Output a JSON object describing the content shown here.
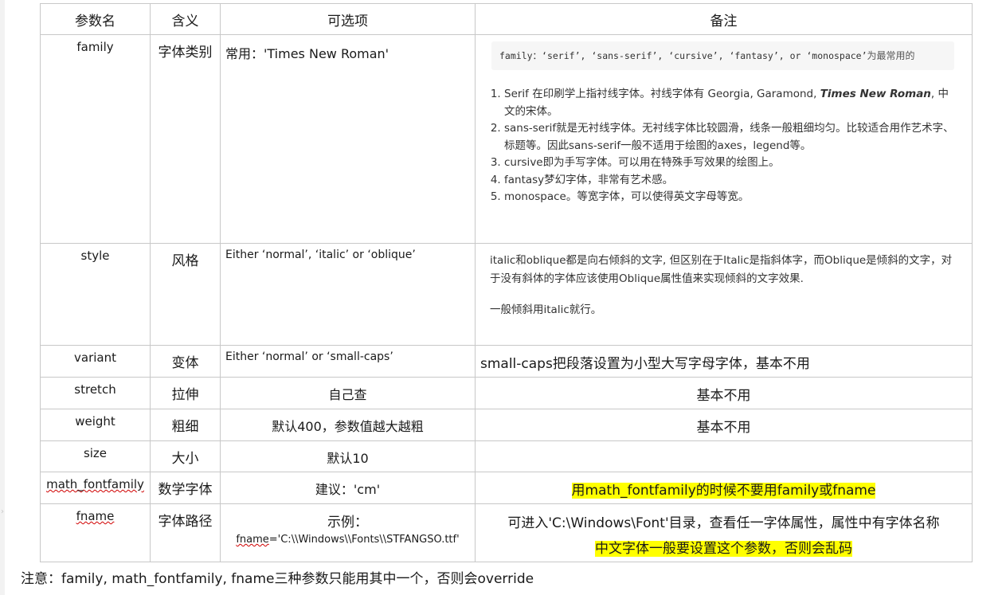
{
  "headers": {
    "name": "参数名",
    "meaning": "含义",
    "options": "可选项",
    "remarks": "备注"
  },
  "rows": {
    "family": {
      "name": "family",
      "meaning": "字体类别",
      "options": "常用：'Times New Roman'",
      "code_en": "family：‘serif’, ‘sans-serif’, ‘cursive’, ‘fantasy’, or ‘monospace’",
      "code_cn": "为最常用的",
      "list": [
        {
          "pre": "Serif 在印刷学上指衬线字体。衬线字体有 Georgia, Garamond, ",
          "emph": "Times New Roman",
          "post": ", 中文的宋体。"
        },
        {
          "text": "sans-serif就是无衬线字体。无衬线字体比较圆滑，线条一般粗细均匀。比较适合用作艺术字、标题等。因此sans-serif一般不适用于绘图的axes，legend等。"
        },
        {
          "text": "cursive即为手写字体。可以用在特殊手写效果的绘图上。"
        },
        {
          "text": "fantasy梦幻字体，非常有艺术感。"
        },
        {
          "text": "monospace。等宽字体，可以使得英文字母等宽。"
        }
      ]
    },
    "style": {
      "name": "style",
      "meaning": "风格",
      "options": "Either ‘normal’, ‘italic’ or ‘oblique’",
      "note1": "italic和oblique都是向右倾斜的文字, 但区别在于Italic是指斜体字，而Oblique是倾斜的文字，对于没有斜体的字体应该使用Oblique属性值来实现倾斜的文字效果.",
      "note2": "一般倾斜用italic就行。"
    },
    "variant": {
      "name": "variant",
      "meaning": "变体",
      "options": "Either ‘normal’ or ‘small-caps’",
      "remark": "small-caps把段落设置为小型大写字母字体，基本不用"
    },
    "stretch": {
      "name": "stretch",
      "meaning": "拉伸",
      "options": "自己查",
      "remark": "基本不用"
    },
    "weight": {
      "name": "weight",
      "meaning": "粗细",
      "options": "默认400，参数值越大越粗",
      "remark": "基本不用"
    },
    "size": {
      "name": "size",
      "meaning": "大小",
      "options": "默认10",
      "remark": ""
    },
    "math": {
      "name": "math_fontfamily",
      "meaning": "数学字体",
      "options": "建议：'cm'",
      "remark": "用math_fontfamily的时候不要用family或fname"
    },
    "fname": {
      "name": "fname",
      "meaning": "字体路径",
      "options_label": "示例：",
      "options_code_kw": "fname",
      "options_code_rest": "='C:\\\\Windows\\\\Fonts\\\\STFANGSO.ttf'",
      "remark1": "可进入'C:\\Windows\\Font'目录，查看任一字体属性，属性中有字体名称",
      "remark2": "中文字体一般要设置这个参数，否则会乱码"
    }
  },
  "footnote": "注意：family, math_fontfamily, fname三种参数只能用其中一个，否则会override",
  "colors": {
    "highlight": "#ffff00",
    "border": "#c8c8c8",
    "code_bg": "#f6f6f6",
    "spell_underline": "#d00000"
  }
}
